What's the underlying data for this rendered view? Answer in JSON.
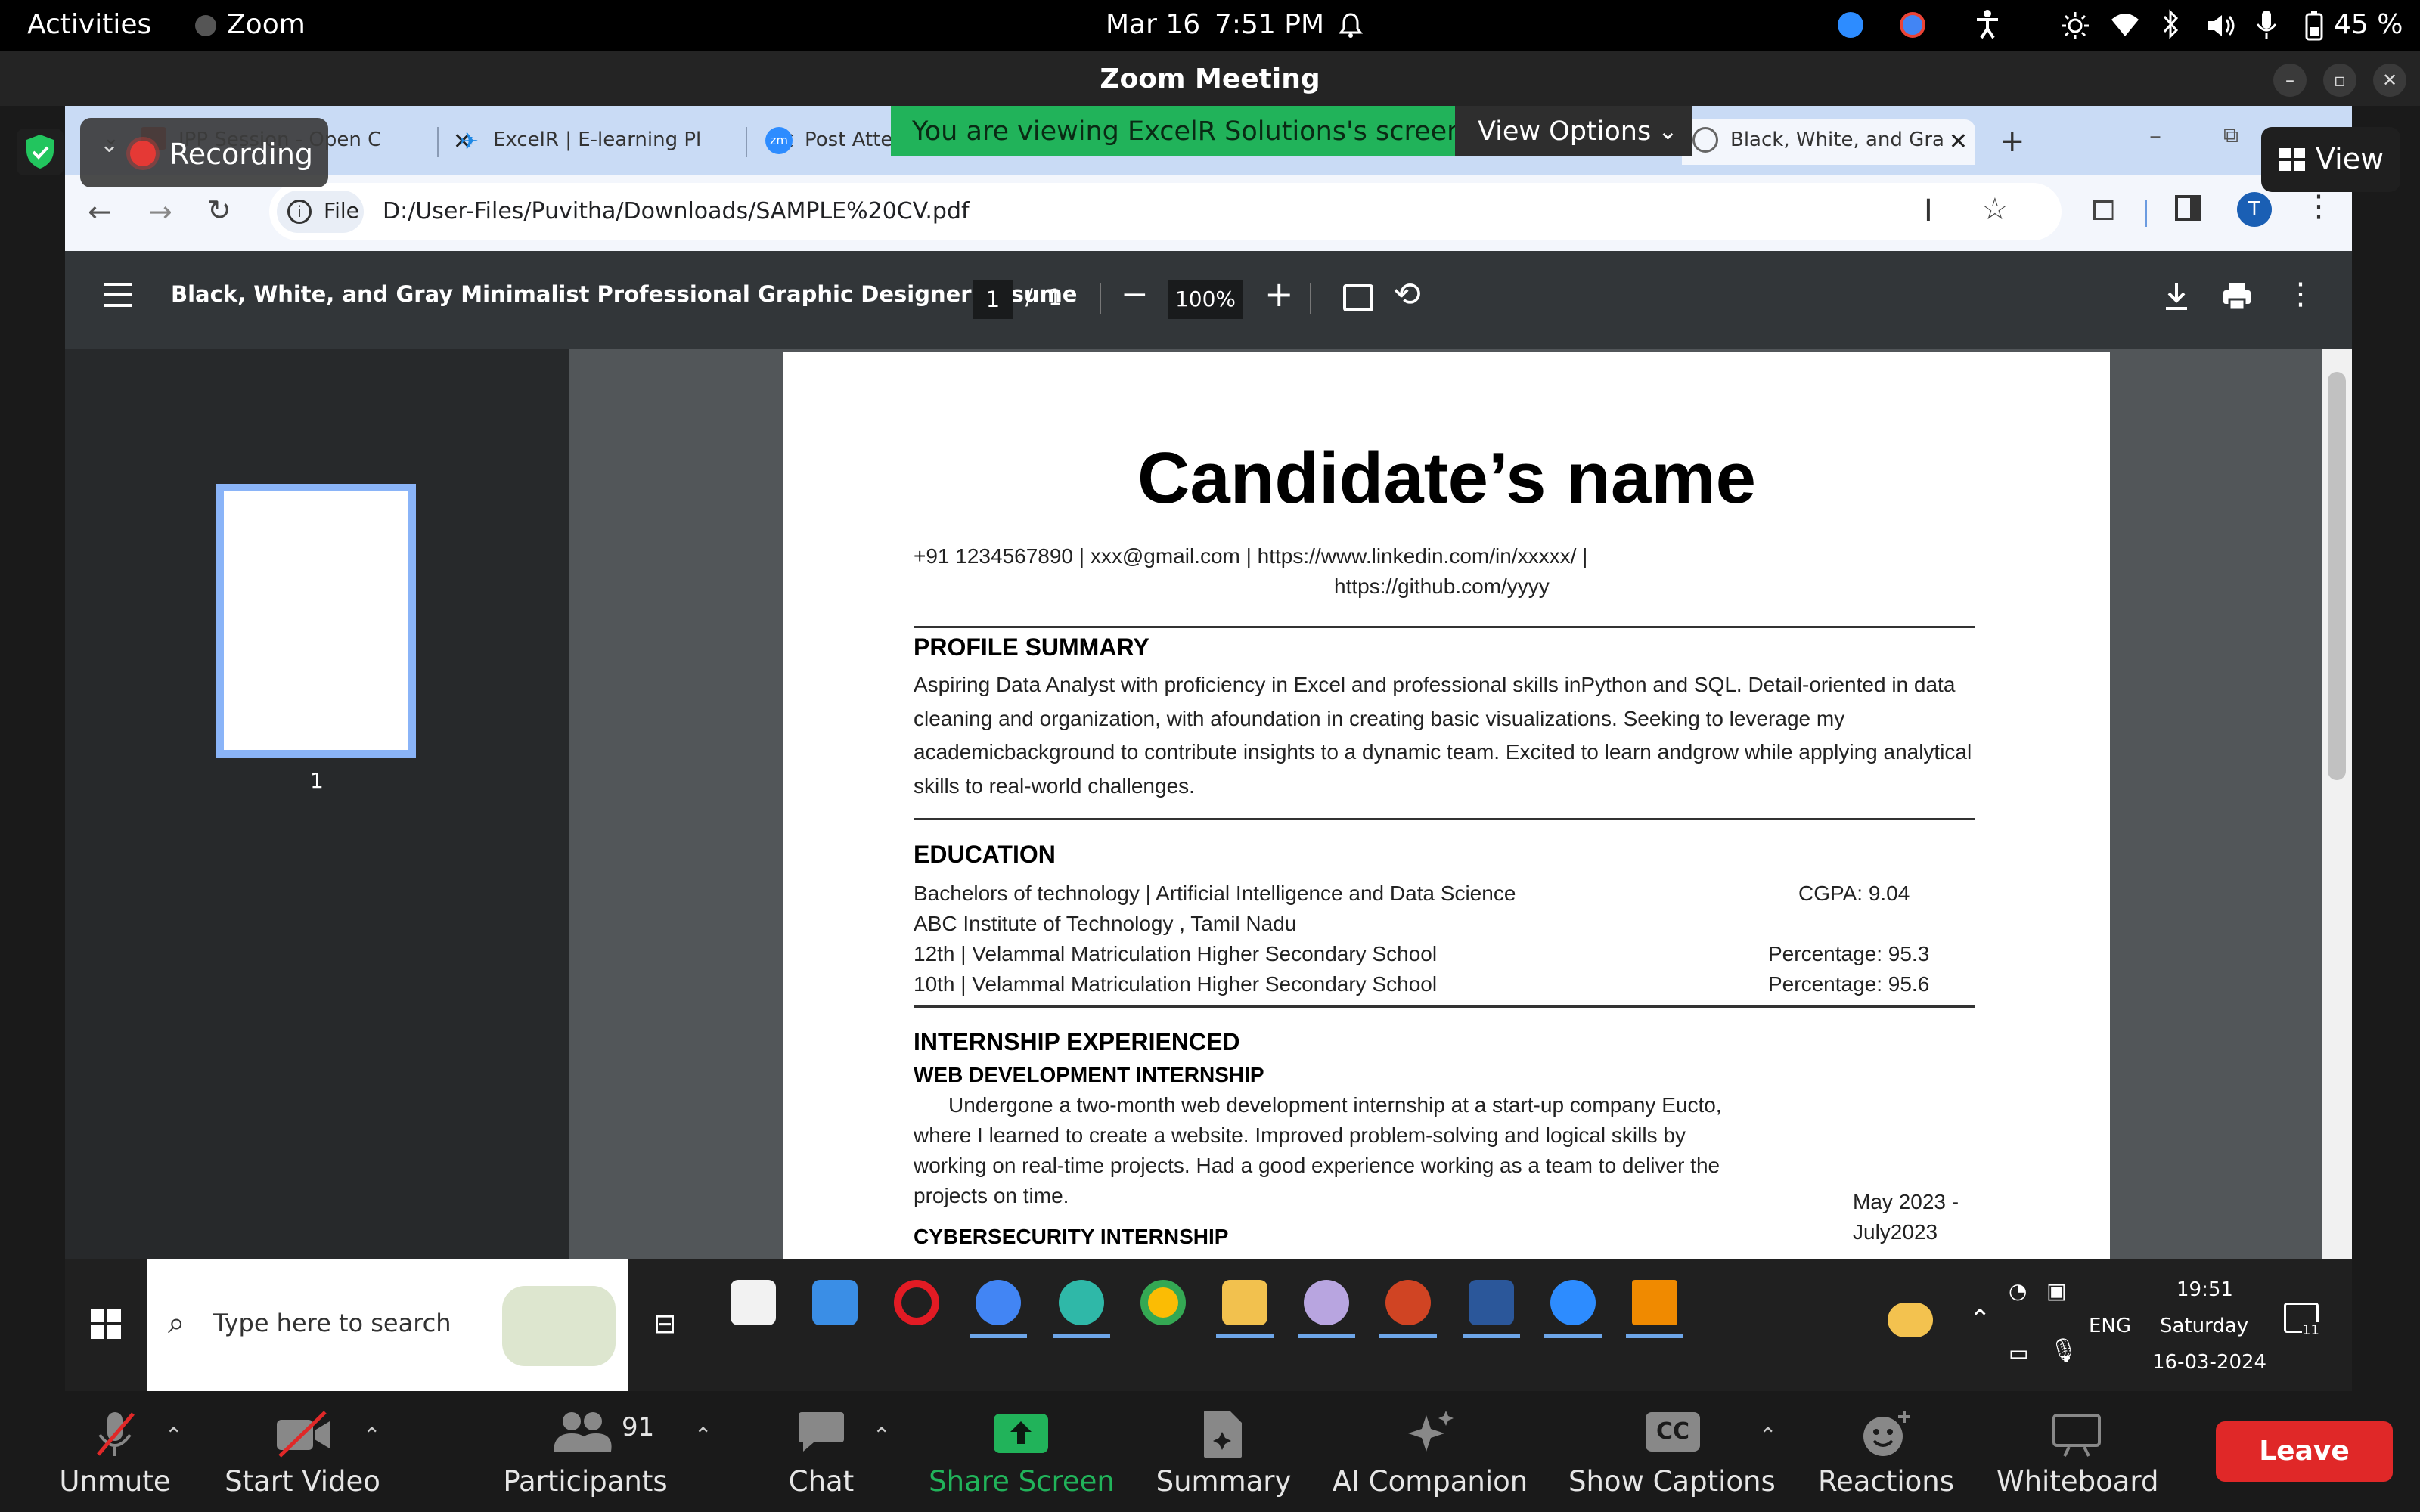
{
  "gnome": {
    "activities": "Activities",
    "app_name": "Zoom",
    "date": "Mar 16",
    "time": "7:51 PM",
    "battery": "45 %"
  },
  "zoom_window": {
    "title": "Zoom Meeting"
  },
  "overlays": {
    "recording": "Recording",
    "viewing_banner": "You are viewing ExcelR Solutions's screen",
    "view_options": "View Options",
    "view_button": "View"
  },
  "chrome": {
    "tabs": [
      {
        "label": "IPP Session - Open C"
      },
      {
        "label": "ExcelR | E-learning Pl"
      },
      {
        "label": "Post Atter"
      },
      {
        "label": "Black, White, and Gra"
      }
    ],
    "file_chip": "File",
    "url": "D:/User-Files/Puvitha/Downloads/SAMPLE%20CV.pdf",
    "profile_initial": "T"
  },
  "pdf": {
    "title": "Black, White, and Gray Minimalist Professional Graphic Designer Resume",
    "page_current": "1",
    "page_sep": "/",
    "page_total": "1",
    "zoom": "100%",
    "thumb_label": "1"
  },
  "resume": {
    "name": "Candidate’s name",
    "contact_line1": "+91 1234567890 | xxx@gmail.com | https://www.linkedin.com/in/xxxxx/ |",
    "contact_line2": "https://github.com/yyyy",
    "profile_heading": "PROFILE SUMMARY",
    "profile_text": "Aspiring Data Analyst with proficiency in Excel and professional skills inPython and SQL. Detail-oriented in data cleaning and organization, with afoundation in creating basic visualizations. Seeking to leverage my academicbackground to contribute insights to a dynamic team. Excited to learn andgrow while applying analytical skills to real-world challenges.",
    "education_heading": "EDUCATION",
    "edu_rows": [
      {
        "left": "Bachelors of technology | Artificial Intelligence and Data Science",
        "right": "CGPA: 9.04"
      },
      {
        "left": "ABC Institute of Technology , Tamil Nadu",
        "right": ""
      },
      {
        "left": "12th | Velammal Matriculation Higher Secondary School",
        "right": "Percentage: 95.3"
      },
      {
        "left": "10th | Velammal Matriculation Higher Secondary School",
        "right": "Percentage: 95.6"
      }
    ],
    "internship_heading": "INTERNSHIP EXPERIENCED",
    "web_heading": "WEB DEVELOPMENT INTERNSHIP",
    "web_text": "Undergone a two-month web development internship at a start-up company Eucto, where I learned to create a website. Improved problem-solving and logical skills by working on real-time projects. Had a good experience working as a team to deliver the projects on time.",
    "web_date_1": "May 2023 -",
    "web_date_2": "July2023",
    "cyber_heading": "CYBERSECURITY INTERNSHIP"
  },
  "taskbar": {
    "search_placeholder": "Type here to search",
    "lang": "ENG",
    "time": "19:51",
    "day": "Saturday",
    "date": "16-03-2024",
    "notif_count": "11"
  },
  "zoom_toolbar": {
    "unmute": "Unmute",
    "start_video": "Start Video",
    "participants": "Participants",
    "participants_count": "91",
    "chat": "Chat",
    "share_screen": "Share Screen",
    "summary": "Summary",
    "ai_companion": "AI Companion",
    "show_captions": "Show Captions",
    "cc": "CC",
    "reactions": "Reactions",
    "whiteboard": "Whiteboard",
    "leave": "Leave"
  },
  "colors": {
    "share_green": "#21b35a",
    "leave_red": "#e02828",
    "chrome_tabstrip": "#c9dbf5",
    "pdf_toolbar": "#323639"
  }
}
